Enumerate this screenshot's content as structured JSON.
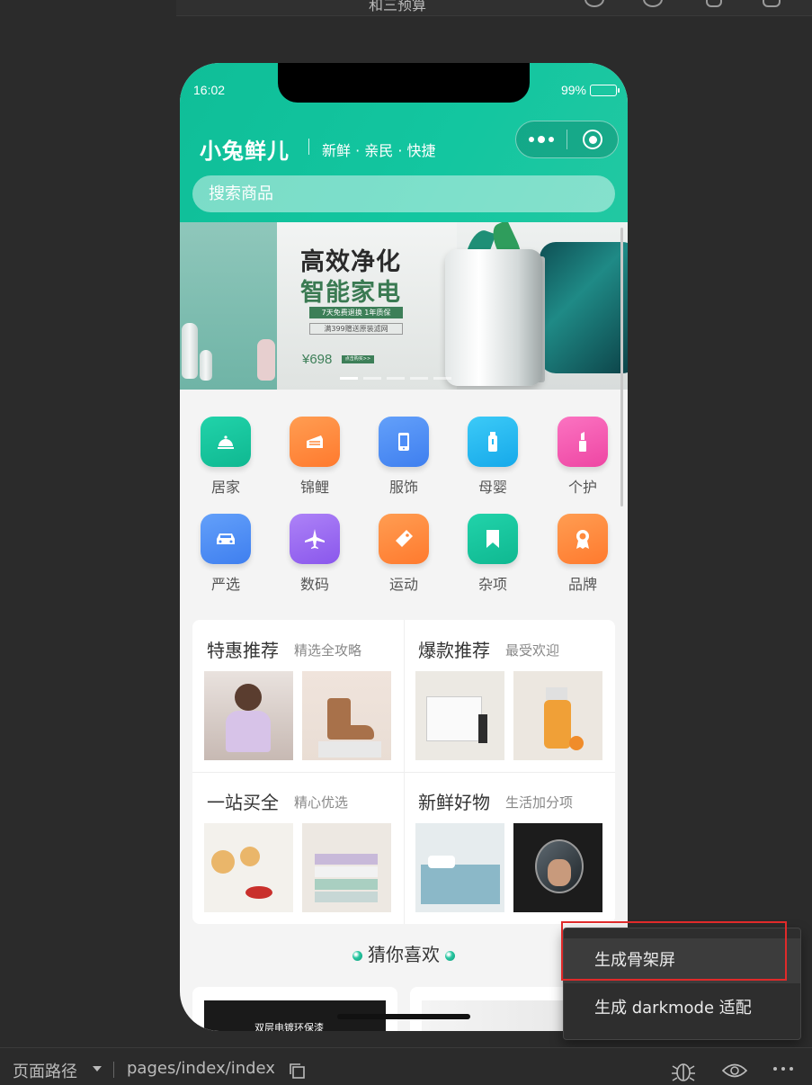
{
  "ide": {
    "top_cut_text": "和三预算",
    "bottom": {
      "path_label": "页面路径",
      "path_value": "pages/index/index"
    }
  },
  "status_bar": {
    "time": "16:02",
    "battery": "99%"
  },
  "header": {
    "brand": "小兔鲜儿",
    "slogan": "新鲜 · 亲民 · 快捷",
    "search_placeholder": "搜索商品"
  },
  "banner": {
    "title1": "高效净化",
    "title2": "智能家电",
    "tag1": "7天免费退换 1年质保",
    "tag2": "满399赠送原装滤网",
    "price": "¥698",
    "button": "点击购买>>"
  },
  "categories": [
    {
      "label": "居家",
      "icon": "cloche-icon",
      "color": "#13c19b"
    },
    {
      "label": "锦鲤",
      "icon": "cake-icon",
      "color": "#ff8a3d"
    },
    {
      "label": "服饰",
      "icon": "phone-icon",
      "color": "#4d8ef7"
    },
    {
      "label": "母婴",
      "icon": "bottle-icon",
      "color": "#26b8f2"
    },
    {
      "label": "个护",
      "icon": "lipstick-icon",
      "color": "#f25cb1"
    },
    {
      "label": "严选",
      "icon": "car-icon",
      "color": "#4d8ef7"
    },
    {
      "label": "数码",
      "icon": "plane-icon",
      "color": "#9b6cf2"
    },
    {
      "label": "运动",
      "icon": "tag-icon",
      "color": "#ff8a3d"
    },
    {
      "label": "杂项",
      "icon": "bookmark-icon",
      "color": "#13c19b"
    },
    {
      "label": "品牌",
      "icon": "badge-icon",
      "color": "#ff8a3d"
    }
  ],
  "recommend": [
    {
      "title": "特惠推荐",
      "sub": "精选全攻略"
    },
    {
      "title": "爆款推荐",
      "sub": "最受欢迎"
    },
    {
      "title": "一站买全",
      "sub": "精心优选"
    },
    {
      "title": "新鲜好物",
      "sub": "生活加分项"
    }
  ],
  "guess": {
    "title": "猜你喜欢",
    "card_text": "双层电镀环保漆"
  },
  "menu": {
    "item1": "生成骨架屏",
    "item2": "生成 darkmode 适配"
  },
  "colors": {
    "brand_green": "#13c19b",
    "highlight_red": "#e02a2a"
  }
}
